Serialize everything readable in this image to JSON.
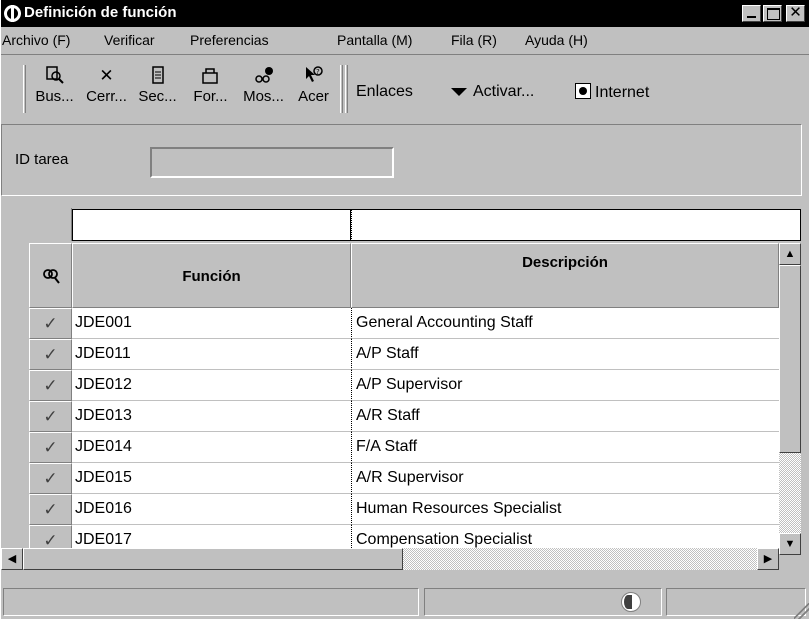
{
  "window": {
    "title": "Definición de función"
  },
  "menu": [
    {
      "label": "Archivo (F)"
    },
    {
      "label": "Verificar"
    },
    {
      "label": "Preferencias"
    },
    {
      "label": "Pantalla (M)"
    },
    {
      "label": "Fila (R)"
    },
    {
      "label": "Ayuda (H)"
    }
  ],
  "toolbar": {
    "tools": [
      {
        "label": "Bus...",
        "icon": "find-icon"
      },
      {
        "label": "Cerr...",
        "icon": "close-icon"
      },
      {
        "label": "Sec...",
        "icon": "next-icon"
      },
      {
        "label": "For...",
        "icon": "form-icon"
      },
      {
        "label": "Mos...",
        "icon": "display-icon"
      },
      {
        "label": "Acer",
        "icon": "about-icon"
      }
    ],
    "links": {
      "enlaces": "Enlaces",
      "activar": "Activar...",
      "internet": "Internet"
    }
  },
  "header": {
    "id_tarea_label": "ID tarea",
    "id_tarea_value": ""
  },
  "grid": {
    "columns": [
      "Función",
      "Descripción"
    ],
    "rows": [
      {
        "funcion": "JDE001",
        "descripcion": "General Accounting Staff"
      },
      {
        "funcion": "JDE011",
        "descripcion": "A/P Staff"
      },
      {
        "funcion": "JDE012",
        "descripcion": "A/P Supervisor"
      },
      {
        "funcion": "JDE013",
        "descripcion": "A/R Staff"
      },
      {
        "funcion": "JDE014",
        "descripcion": "F/A Staff"
      },
      {
        "funcion": "JDE015",
        "descripcion": "A/R Supervisor"
      },
      {
        "funcion": "JDE016",
        "descripcion": "Human Resources Specialist"
      },
      {
        "funcion": "JDE017",
        "descripcion": "Compensation Specialist"
      }
    ]
  }
}
